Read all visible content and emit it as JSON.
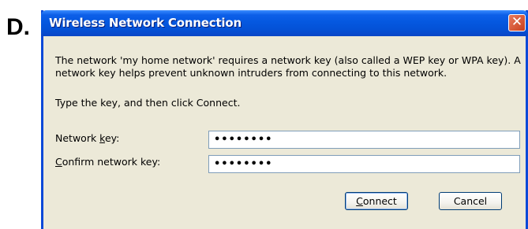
{
  "figure_label": "D.",
  "window": {
    "title": "Wireless Network Connection",
    "close_glyph": "✕"
  },
  "message": {
    "paragraph1": "The network 'my home network' requires a network key (also called a WEP key or WPA key). A network key helps prevent unknown intruders from connecting to this network.",
    "paragraph2": "Type the key, and then click Connect."
  },
  "fields": {
    "network_key": {
      "label_pre": "Network ",
      "label_mnemonic": "k",
      "label_post": "ey:",
      "value": "••••••••"
    },
    "confirm_key": {
      "label_pre": "",
      "label_mnemonic": "C",
      "label_post": "onfirm network key:",
      "value": "••••••••"
    }
  },
  "buttons": {
    "connect_mnemonic": "C",
    "connect_rest": "onnect",
    "cancel_label": "Cancel"
  },
  "colors": {
    "title_bar": "#0558e0",
    "dialog_bg": "#ece9d8",
    "close_button": "#c9401d"
  },
  "icons": {
    "close": "close-icon"
  }
}
